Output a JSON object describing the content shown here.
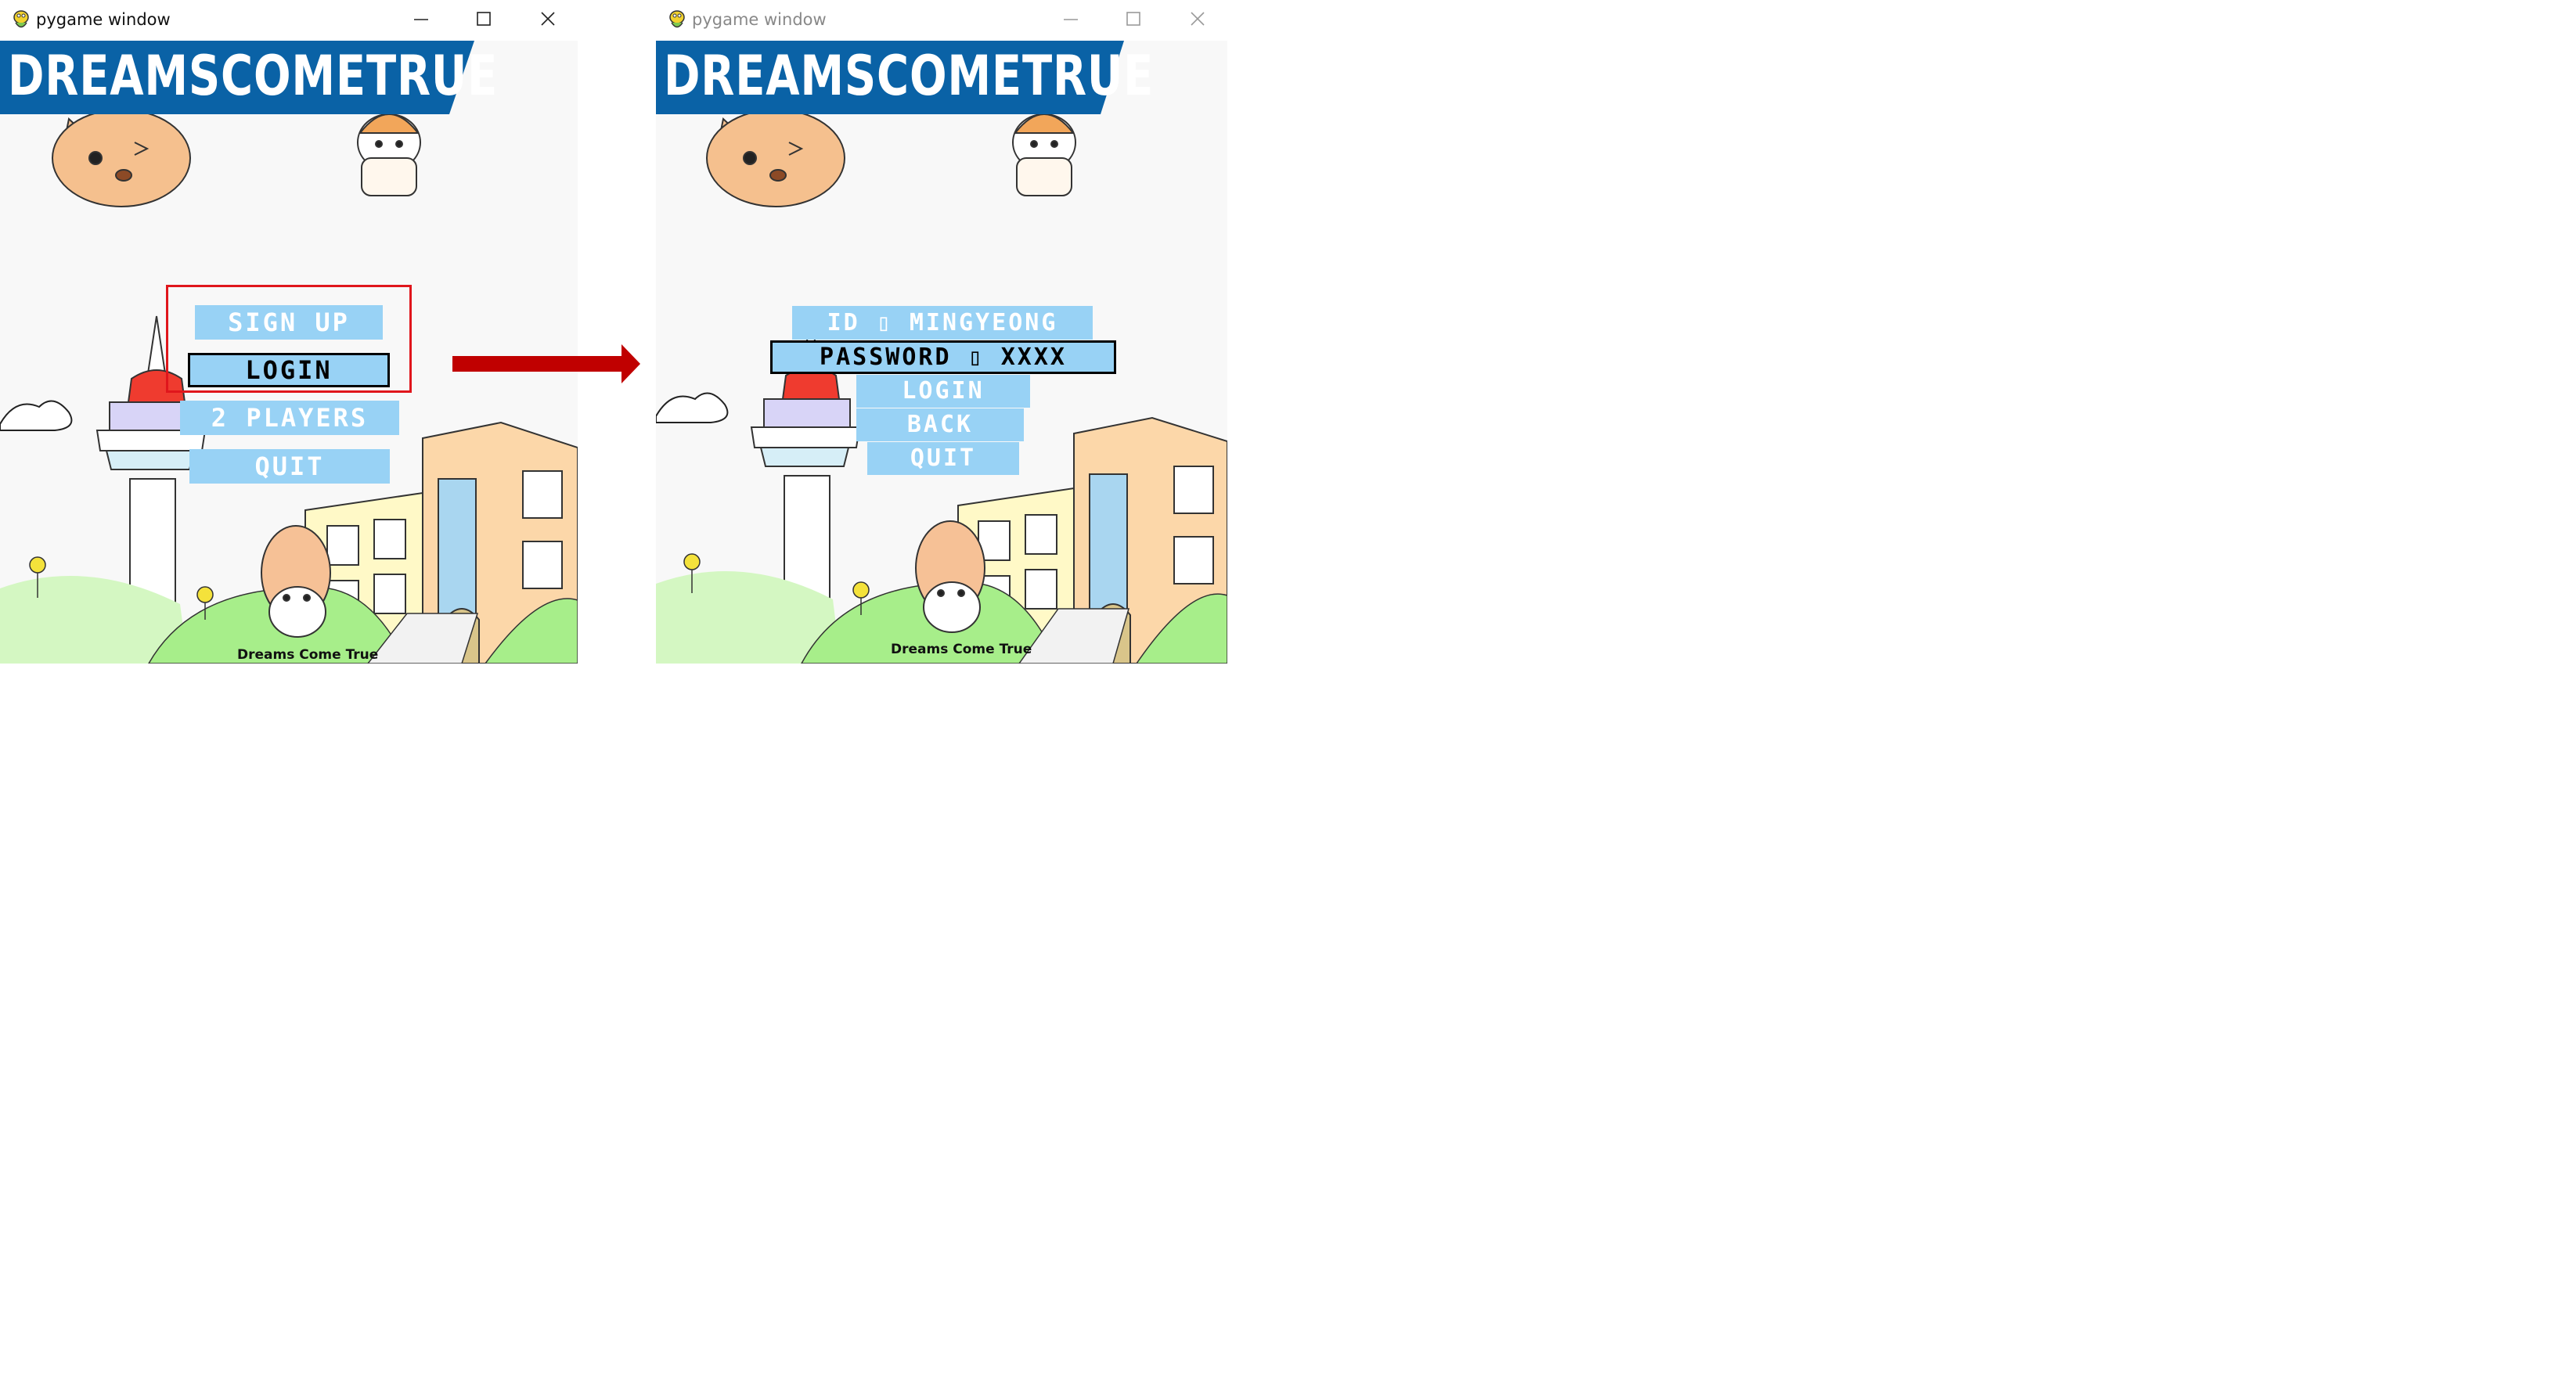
{
  "left_window": {
    "title": "pygame window",
    "banner": "DREAMSCOMETRUE",
    "menu": [
      {
        "label": "SIGN UP"
      },
      {
        "label": "LOGIN",
        "selected": true
      },
      {
        "label": "2 PLAYERS"
      },
      {
        "label": "QUIT"
      }
    ],
    "footer": "Dreams Come True"
  },
  "right_window": {
    "title": "pygame window",
    "banner": "DREAMSCOMETRUE",
    "id_field": "ID ▯ MINGYEONG",
    "password_field": "PASSWORD ▯ XXXX",
    "menu": [
      {
        "label": "LOGIN"
      },
      {
        "label": "BACK"
      },
      {
        "label": "QUIT"
      }
    ],
    "footer": "Dreams Come True"
  },
  "colors": {
    "banner_blue": "#0a62a6",
    "button_blue": "#98d2f5",
    "highlight_red": "#e0161c",
    "arrow_red": "#c00000",
    "grass_green": "#a7ee8a"
  },
  "icons": {
    "app": "pygame-snake-icon",
    "minimize": "minimize-icon",
    "maximize": "maximize-icon",
    "close": "close-icon",
    "arrow": "right-arrow-icon"
  }
}
